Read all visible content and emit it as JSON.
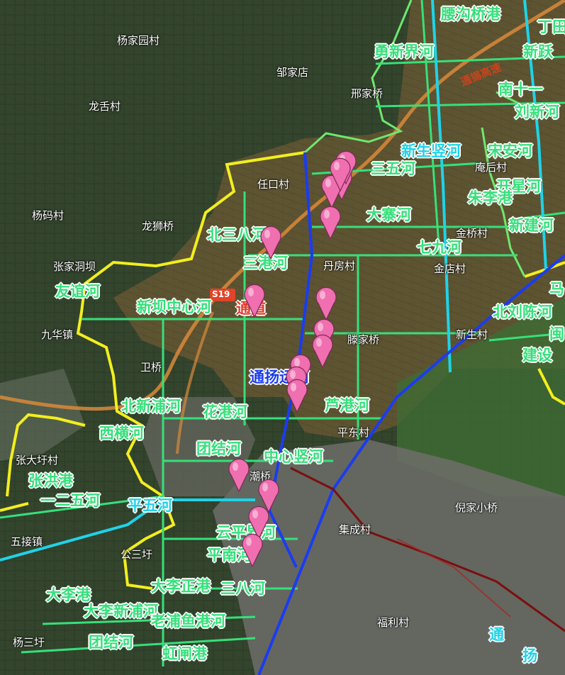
{
  "map": {
    "place_labels": [
      "杨家园村",
      "邹家店",
      "邢家桥",
      "龙舌村",
      "任口村",
      "杨码村",
      "龙狮桥",
      "张家洞坝",
      "九华镇",
      "卫桥",
      "丹房村",
      "金桥村",
      "金店村",
      "滕家桥",
      "新生村",
      "平东村",
      "张大圩村",
      "五接镇",
      "公三圩",
      "潮桥",
      "集成村",
      "倪家小桥",
      "福利村",
      "杨三圩",
      "庵后村"
    ],
    "river_labels": [
      "腰沟桥港",
      "丁田",
      "勇新界河",
      "新跃",
      "南十一",
      "刘新河",
      "新生竖河",
      "宋安河",
      "三五河",
      "开星河",
      "朱李港",
      "大寨河",
      "新建河",
      "七九河",
      "北三八河",
      "三港河",
      "马",
      "北刘陈河",
      "闽",
      "友谊河",
      "新坝中心河",
      "建设",
      "通扬运河",
      "北新浦河",
      "花港河",
      "芦港河",
      "西横河",
      "团结河",
      "中心竖河",
      "张洪港",
      "一二五河",
      "平五河",
      "云平界河",
      "平南河",
      "大李正港",
      "三八河",
      "大李港",
      "大李新浦河",
      "老浦鱼港河",
      "团结河",
      "虹闸港",
      "通",
      "扬"
    ],
    "red_labels": [
      "通道"
    ],
    "highway_label": "通锡高速",
    "road_shield": "S19",
    "marker_count": 17,
    "marker_color": "#f06fb0",
    "colors": {
      "river_green": "#36e07a",
      "river_cyan": "#1fd3e8",
      "main_canal": "#1b3cf0",
      "boundary": "#f2ee1e",
      "boundary_green": "#6ee86e",
      "railway": "#7a1010"
    }
  }
}
